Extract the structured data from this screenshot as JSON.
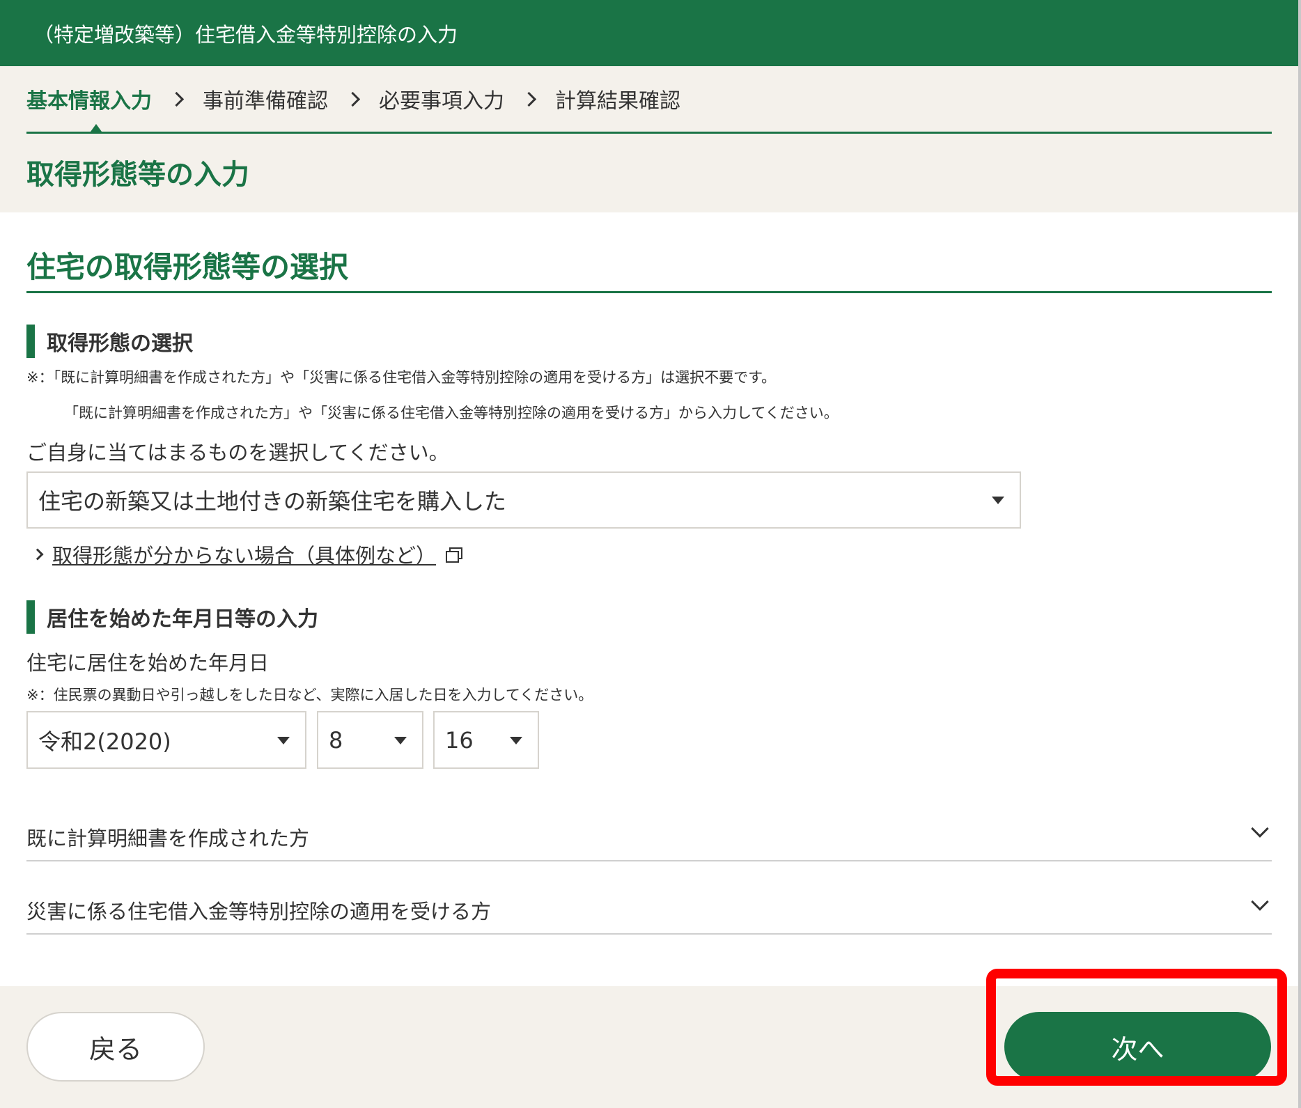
{
  "header": {
    "title": "（特定増改築等）住宅借入金等特別控除の入力"
  },
  "steps": [
    {
      "label": "基本情報入力",
      "active": true
    },
    {
      "label": "事前準備確認"
    },
    {
      "label": "必要事項入力"
    },
    {
      "label": "計算結果確認"
    }
  ],
  "page_title": "取得形態等の入力",
  "section_title": "住宅の取得形態等の選択",
  "acquisition": {
    "heading": "取得形態の選択",
    "note1": "※：「既に計算明細書を作成された方」や「災害に係る住宅借入金等特別控除の適用を受ける方」は選択不要です。",
    "note2": "「既に計算明細書を作成された方」や「災害に係る住宅借入金等特別控除の適用を受ける方」から入力してください。",
    "instruction": "ご自身に当てはまるものを選択してください。",
    "selected": "住宅の新築又は土地付きの新築住宅を購入した",
    "help_link": "取得形態が分からない場合（具体例など）"
  },
  "residence": {
    "heading": "居住を始めた年月日等の入力",
    "label": "住宅に居住を始めた年月日",
    "note": "※：住民票の異動日や引っ越しをした日など、実際に入居した日を入力してください。",
    "year": "令和2(2020)",
    "month": "8",
    "day": "16"
  },
  "accordions": [
    {
      "label": "既に計算明細書を作成された方"
    },
    {
      "label": "災害に係る住宅借入金等特別控除の適用を受ける方"
    }
  ],
  "footer": {
    "back_label": "戻る",
    "next_label": "次へ"
  },
  "colors": {
    "brand": "#1a7446",
    "band": "#f4f1eb",
    "highlight": "#ff0000"
  },
  "icons": [
    "chevron-right-icon",
    "caret-down-icon",
    "new-window-icon",
    "chevron-down-icon"
  ]
}
